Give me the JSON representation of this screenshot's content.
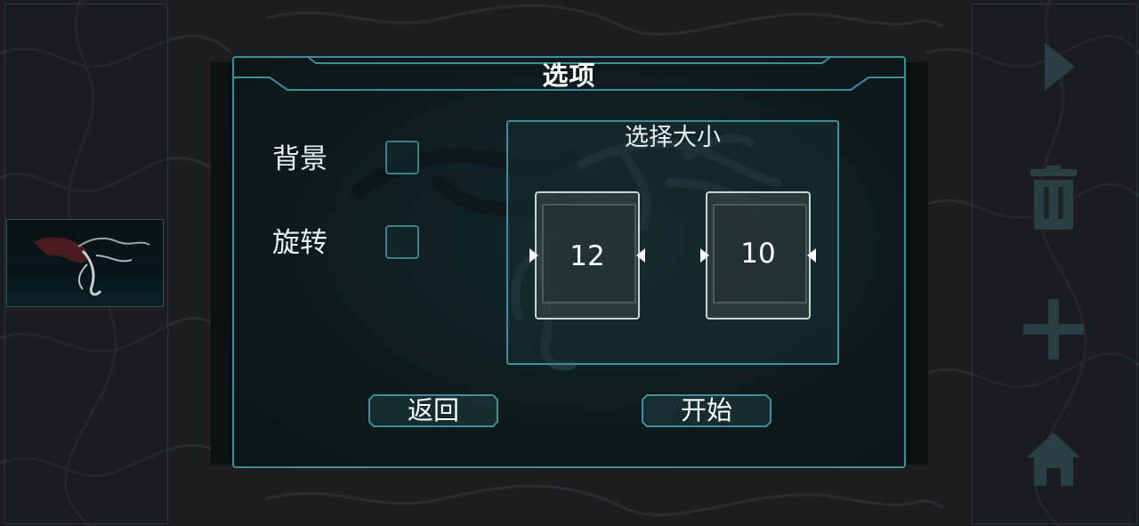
{
  "dialog": {
    "title": "选项",
    "options": [
      {
        "label": "背景",
        "checked": false
      },
      {
        "label": "旋转",
        "checked": false
      }
    ],
    "size_panel": {
      "title": "选择大小",
      "width_value": "12",
      "height_value": "10"
    },
    "buttons": {
      "back": "返回",
      "start": "开始"
    }
  },
  "sidebar_right": {
    "icons": [
      "play-icon",
      "trash-icon",
      "plus-icon",
      "home-icon"
    ]
  },
  "colors": {
    "background": "#1c1d21",
    "accent": "#3c8f98",
    "panel_icon": "#2a3f44"
  }
}
